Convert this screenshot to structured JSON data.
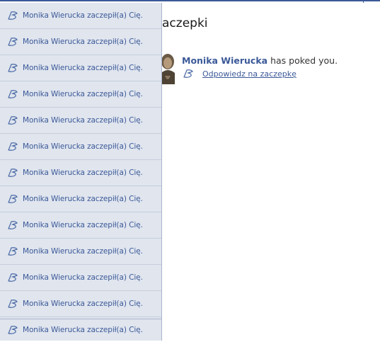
{
  "page": {
    "title": "aczepki",
    "poke": {
      "name": "Monika Wierucka",
      "message": " has poked you.",
      "reply_label": "Odpowiedz na zaczepkę"
    }
  },
  "notifications": {
    "items": [
      {
        "text": "Monika Wierucka zaczepił(a) Cię.",
        "icon": "poke-icon"
      },
      {
        "text": "Monika Wierucka zaczepił(a) Cię.",
        "icon": "poke-icon"
      },
      {
        "text": "Monika Wierucka zaczepił(a) Cię.",
        "icon": "poke-icon"
      },
      {
        "text": "Monika Wierucka zaczepił(a) Cię.",
        "icon": "poke-icon"
      },
      {
        "text": "Monika Wierucka zaczepił(a) Cię.",
        "icon": "poke-icon"
      },
      {
        "text": "Monika Wierucka zaczepił(a) Cię.",
        "icon": "poke-icon"
      },
      {
        "text": "Monika Wierucka zaczepił(a) Cię.",
        "icon": "poke-icon"
      },
      {
        "text": "Monika Wierucka zaczepił(a) Cię.",
        "icon": "poke-icon"
      },
      {
        "text": "Monika Wierucka zaczepił(a) Cię.",
        "icon": "poke-icon"
      },
      {
        "text": "Monika Wierucka zaczepił(a) Cię.",
        "icon": "poke-icon"
      },
      {
        "text": "Monika Wierucka zaczepił(a) Cię.",
        "icon": "poke-icon"
      },
      {
        "text": "Monika Wierucka zaczepił(a) Cię.",
        "icon": "poke-icon"
      }
    ],
    "tail": {
      "text": "Monika Wierucka zaczepił(a) Cię.",
      "icon": "poke-icon"
    }
  },
  "colors": {
    "link": "#3b5998",
    "panel_bg": "#e0e5ee",
    "panel_border": "#a9b5cc",
    "divider": "#c6cedc"
  }
}
